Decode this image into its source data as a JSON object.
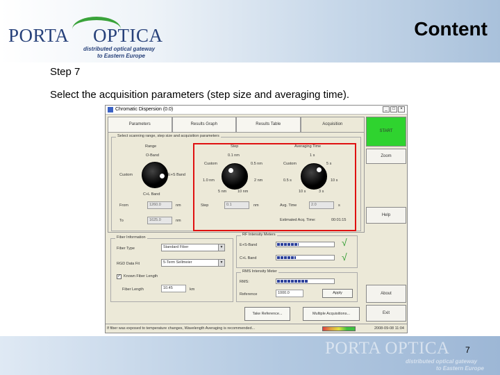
{
  "header": {
    "logo_porta": "PORTA",
    "logo_optica": "OPTICA",
    "logo_tagline_1": "distributed optical gateway",
    "logo_tagline_2": "to Eastern Europe",
    "title": "Content"
  },
  "slide": {
    "step": "Step 7",
    "instruction": "Select the acquisition parameters (step size and averaging time).",
    "page_number": "7"
  },
  "app": {
    "window_title": "Chromatic Dispersion (0.0)",
    "titlebar_buttons": [
      "_",
      "□",
      "×"
    ],
    "tabs": [
      "Parameters",
      "Results Graph",
      "Results Table",
      "Acquisition"
    ],
    "selected_tab": "Acquisition",
    "params_group_title": "Select scanning range, step size and acquisition parameters",
    "range": {
      "label": "Range",
      "top": "O-Band",
      "left": "Custom",
      "right": "E+S Band",
      "bottom": "C+L Band",
      "from_label": "From",
      "from_value": "1260.0",
      "to_label": "To",
      "to_value": "1625.0",
      "unit": "nm"
    },
    "step": {
      "label": "Step",
      "tl": "Custom",
      "top": "0.1 nm",
      "tr": "0.5 nm",
      "left": "1.0 nm",
      "right": "2 nm",
      "bl": "5 nm",
      "br": "10 nm",
      "field_label": "Step",
      "field_value": "0.1",
      "unit": "nm"
    },
    "averaging": {
      "label": "Averaging Time",
      "tl": "Custom",
      "top": "1 s",
      "tr": "5 s",
      "left": "0.5 s",
      "right": "10 s",
      "bl": "10 s",
      "br": "3 s",
      "field_label": "Avg. Time",
      "field_value": "2.0",
      "unit": "s",
      "est_label": "Estimated Acq. Time:",
      "est_value": "00:01:15"
    },
    "fiber": {
      "group_title": "Fiber Information",
      "type_label": "Fiber Type",
      "type_value": "Standard Fiber",
      "fit_label": "RGD Data Fit",
      "fit_value": "5-Term Sellmeier",
      "known_length_label": "Known Fiber Length",
      "known_length_checked": true,
      "length_label": "Fiber Length",
      "length_value": "10.45",
      "length_unit": "km"
    },
    "intensity": {
      "group_title": "RF Intensity Meters",
      "row1_label": "E+S-Band",
      "row1_fill": 0.4,
      "row2_label": "C+L Band",
      "row2_fill": 0.35,
      "check_glyph": "√"
    },
    "ref": {
      "group_title": "RMS Intensity Meter",
      "meter_label": "RMS:",
      "meter_fill": 0.55,
      "ref_label": "Reference",
      "ref_value": "1000.0",
      "apply_label": "Apply"
    },
    "buttons": {
      "start": "START",
      "zoom": "Zoom",
      "help": "Help",
      "about": "About",
      "exit": "Exit",
      "take_reference": "Take Reference...",
      "multiple_acquisitions": "Multiple Acquisitions..."
    },
    "status": {
      "message": "If fiber was exposed to temperature changes, Wavelength Averaging is recommended...",
      "datetime": "2008-09-08 11:04"
    }
  },
  "footer": {
    "logo_text": "PORTA OPTICA",
    "tagline_1": "distributed optical gateway",
    "tagline_2": "to Eastern Europe"
  },
  "colors": {
    "highlight_border": "#e01010",
    "start_button": "#2fd32f",
    "logo_blue": "#27417a",
    "logo_green": "#3aa33a"
  }
}
